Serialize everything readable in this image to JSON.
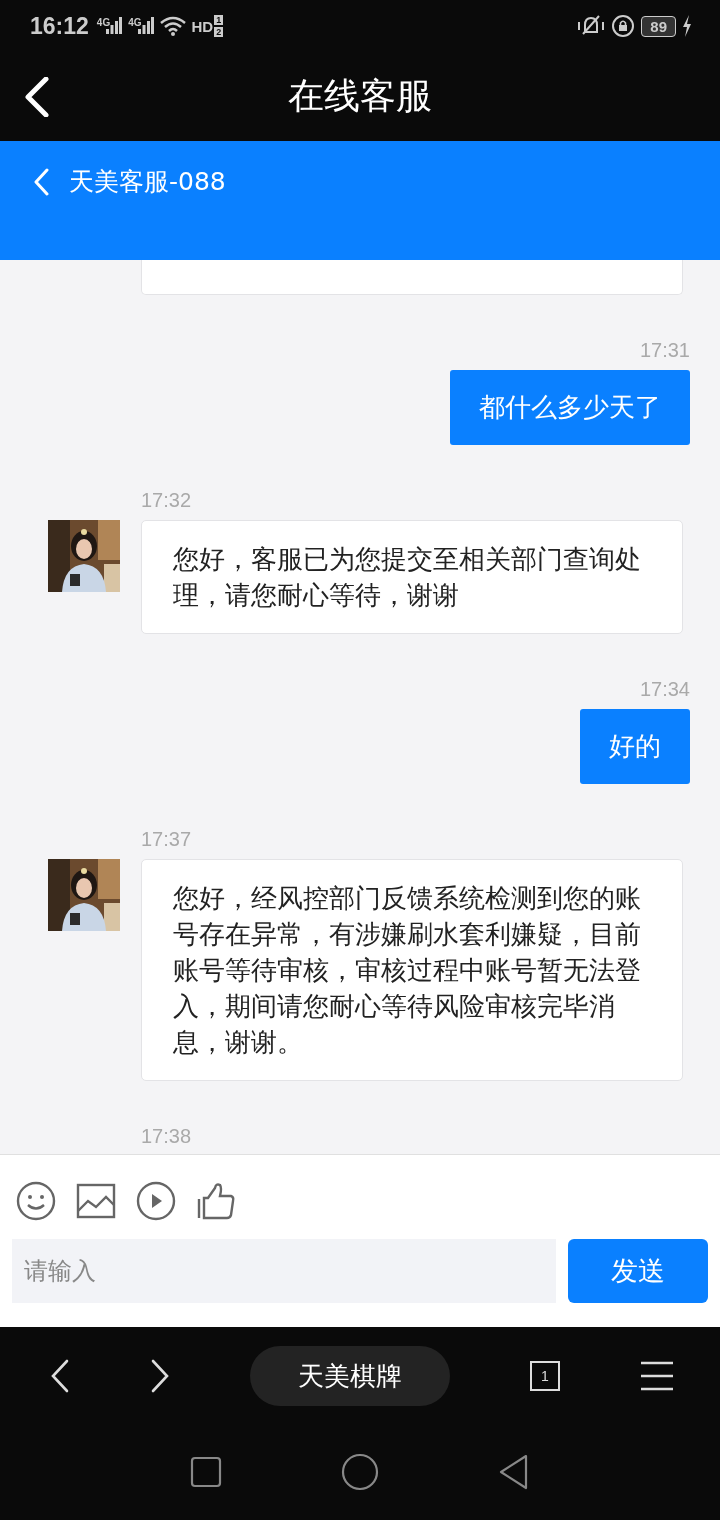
{
  "status_bar": {
    "time": "16:12",
    "network_labels": [
      "4G",
      "4G"
    ],
    "hd_label": "HD",
    "sim_numbers": [
      "1",
      "2"
    ],
    "battery": "89"
  },
  "title_bar": {
    "title": "在线客服"
  },
  "chat_header": {
    "agent": "天美客服-088"
  },
  "messages": [
    {
      "kind": "received",
      "clipped": true
    },
    {
      "kind": "sent",
      "time": "17:31",
      "text": "都什么多少天了"
    },
    {
      "kind": "received",
      "time": "17:32",
      "text": "您好，客服已为您提交至相关部门查询处理，请您耐心等待，谢谢"
    },
    {
      "kind": "sent",
      "time": "17:34",
      "text": "好的"
    },
    {
      "kind": "received",
      "time": "17:37",
      "text": "您好，经风控部门反馈系统检测到您的账号存在异常，有涉嫌刷水套利嫌疑，目前账号等待审核，审核过程中账号暂无法登入，期间请您耐心等待风险审核完毕消息，谢谢。"
    },
    {
      "kind": "time_only",
      "time": "17:38"
    }
  ],
  "composer": {
    "placeholder": "请输入",
    "send_button": "发送"
  },
  "browser_bar": {
    "site_title": "天美棋牌",
    "tab_count": "1"
  }
}
